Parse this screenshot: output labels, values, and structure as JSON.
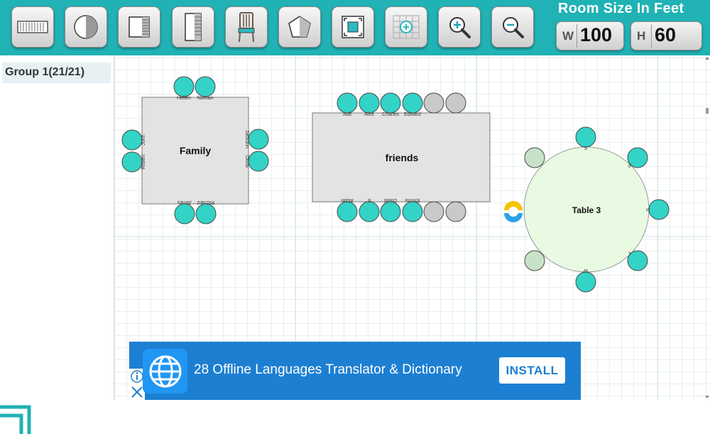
{
  "toolbar": {
    "tools": [
      {
        "name": "rectangle-table-tool",
        "icon": "rectangle-table-icon"
      },
      {
        "name": "round-table-tool",
        "icon": "round-table-icon"
      },
      {
        "name": "square-wall-tool",
        "icon": "square-wall-icon"
      },
      {
        "name": "tall-wall-tool",
        "icon": "tall-wall-icon"
      },
      {
        "name": "chair-tool",
        "icon": "chair-icon"
      },
      {
        "name": "polygon-tool",
        "icon": "pentagon-icon"
      },
      {
        "name": "fit-screen-tool",
        "icon": "fit-screen-icon"
      },
      {
        "name": "grid-tool",
        "icon": "grid-plus-icon"
      },
      {
        "name": "zoom-in-tool",
        "icon": "zoom-in-icon"
      },
      {
        "name": "zoom-out-tool",
        "icon": "zoom-out-icon"
      }
    ],
    "room_title": "Room Size In Feet",
    "width_letter": "W",
    "width_value": "100",
    "height_letter": "H",
    "height_value": "60"
  },
  "sidebar": {
    "group_label": "Group 1(21/21)"
  },
  "canvas": {
    "tables": [
      {
        "name": "Family",
        "shape": "rectangle",
        "seats": [
          {
            "label": "Hellen",
            "occupied": true
          },
          {
            "label": "Noman",
            "occupied": true
          },
          {
            "label": "Jackson",
            "occupied": true
          },
          {
            "label": "Olivia",
            "occupied": true
          },
          {
            "label": "Richard",
            "occupied": true
          },
          {
            "label": "James",
            "occupied": true
          },
          {
            "label": "Robert",
            "occupied": true
          },
          {
            "label": "John",
            "occupied": true
          }
        ]
      },
      {
        "name": "friends",
        "shape": "rectangle",
        "seats": [
          {
            "label": "Adil",
            "occupied": true
          },
          {
            "label": "Alex",
            "occupied": true
          },
          {
            "label": "Charles",
            "occupied": true
          },
          {
            "label": "Edward",
            "occupied": true
          },
          {
            "label": "",
            "occupied": false
          },
          {
            "label": "",
            "occupied": false
          },
          {
            "label": "Aidan",
            "occupied": true
          },
          {
            "label": "B",
            "occupied": true
          },
          {
            "label": "David",
            "occupied": true
          },
          {
            "label": "Emma",
            "occupied": true
          },
          {
            "label": "",
            "occupied": false
          },
          {
            "label": "",
            "occupied": false
          }
        ]
      },
      {
        "name": "Table 3",
        "shape": "round",
        "seats": [
          {
            "label": "S",
            "occupied": true
          },
          {
            "label": "S",
            "occupied": true
          },
          {
            "label": "S",
            "occupied": true
          },
          {
            "label": "Y",
            "occupied": true
          },
          {
            "label": "W",
            "occupied": true
          },
          {
            "label": "",
            "occupied": false
          },
          {
            "label": "",
            "occupied": false
          }
        ]
      }
    ]
  },
  "ad": {
    "text": "28 Offline Languages Translator & Dictionary",
    "button_label": "INSTALL",
    "info_icon": "info-icon",
    "close_icon": "close-icon"
  },
  "colors": {
    "toolbar": "#20b2b4",
    "seat_occupied": "#33d3c7",
    "seat_empty": "#c9c9c9",
    "round_seat_empty": "#c8e2c8",
    "table_fill": "#e3e3e3",
    "round_table_fill": "#e8fbe2",
    "ad_bg": "#1d7fd2"
  }
}
